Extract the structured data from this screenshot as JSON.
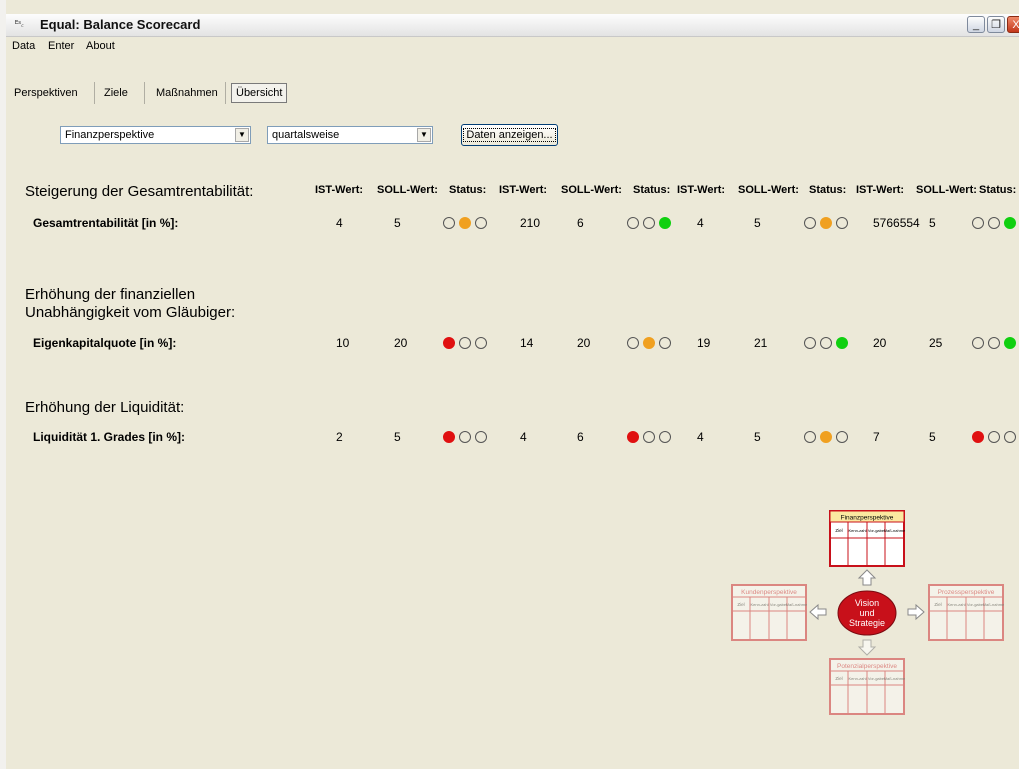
{
  "window": {
    "title": "Equal: Balance Scorecard",
    "icon_glyph": "ᴱˢ꜀",
    "buttons": {
      "minimize": "_",
      "restore": "❐",
      "close": "X"
    }
  },
  "menu": [
    "Data",
    "Enter",
    "About"
  ],
  "tabs": [
    {
      "label": "Perspektiven",
      "active": false
    },
    {
      "label": "Ziele",
      "active": false
    },
    {
      "label": "Maßnahmen",
      "active": false
    },
    {
      "label": "Übersicht",
      "active": true
    }
  ],
  "controls": {
    "perspective_select": "Finanzperspektive",
    "period_select": "quartalsweise",
    "show_button": "Daten anzeigen..."
  },
  "columns": [
    "IST-Wert:",
    "SOLL-Wert:",
    "Status:",
    "IST-Wert:",
    "SOLL-Wert:",
    "Status:",
    "IST-Wert:",
    "SOLL-Wert:",
    "Status:",
    "IST-Wert:",
    "SOLL-Wert:",
    "Status:"
  ],
  "goals": [
    {
      "title": "Steigerung der Gesamtrentabilität:",
      "metric": "Gesamtrentabilität [in %]:",
      "periods": [
        {
          "ist": "4",
          "soll": "5",
          "status": "yellow"
        },
        {
          "ist": "210",
          "soll": "6",
          "status": "green"
        },
        {
          "ist": "4",
          "soll": "5",
          "status": "yellow"
        },
        {
          "ist": "5766554",
          "soll": "5",
          "status": "green"
        }
      ]
    },
    {
      "title": "Erhöhung der finanziellen\nUnabhängigkeit vom Gläubiger:",
      "metric": "Eigenkapitalquote [in %]:",
      "periods": [
        {
          "ist": "10",
          "soll": "20",
          "status": "red"
        },
        {
          "ist": "14",
          "soll": "20",
          "status": "yellow"
        },
        {
          "ist": "19",
          "soll": "21",
          "status": "green"
        },
        {
          "ist": "20",
          "soll": "25",
          "status": "green"
        }
      ]
    },
    {
      "title": "Erhöhung der Liquidität:",
      "metric": "Liquidität 1. Grades [in %]:",
      "periods": [
        {
          "ist": "2",
          "soll": "5",
          "status": "red"
        },
        {
          "ist": "4",
          "soll": "6",
          "status": "red"
        },
        {
          "ist": "4",
          "soll": "5",
          "status": "yellow"
        },
        {
          "ist": "7",
          "soll": "5",
          "status": "red"
        }
      ]
    }
  ],
  "status_colors": {
    "red": "#e01010",
    "yellow": "#f0a020",
    "green": "#10d010"
  },
  "diagram": {
    "center": [
      "Vision",
      "und",
      "Strategie"
    ],
    "top": "Finanzperspektive",
    "left": "Kundenperspektive",
    "right": "Prozessperspektive",
    "bottom": "Potenzialperspektive",
    "columns": [
      "Ziel",
      "Kenn-zahl",
      "Vor-gabe",
      "Maß-nahme"
    ],
    "accent": "#c8101a"
  }
}
